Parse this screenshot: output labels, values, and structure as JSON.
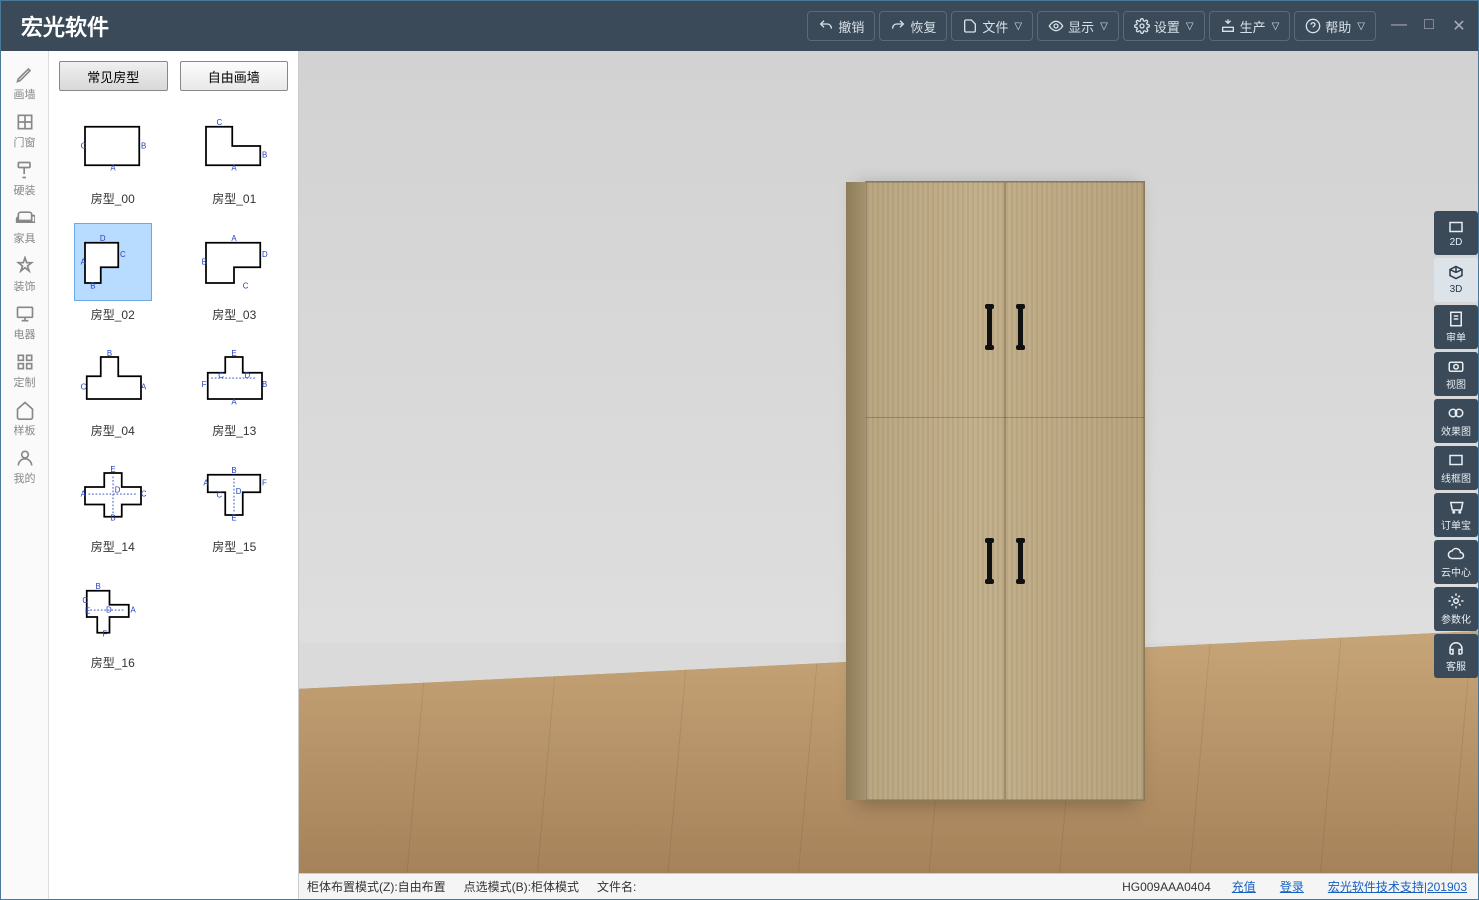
{
  "app": {
    "title": "宏光软件"
  },
  "titlebar": {
    "undo": "撤销",
    "redo": "恢复",
    "file": "文件",
    "display": "显示",
    "settings": "设置",
    "produce": "生产",
    "help": "帮助"
  },
  "leftnav": {
    "wall": "画墙",
    "door": "门窗",
    "hard": "硬装",
    "furniture": "家具",
    "decor": "装饰",
    "appliance": "电器",
    "custom": "定制",
    "template": "样板",
    "mine": "我的"
  },
  "sidepanel": {
    "tab_common": "常见房型",
    "tab_free": "自由画墙",
    "shapes": [
      {
        "id": "s00",
        "label": "房型_00"
      },
      {
        "id": "s01",
        "label": "房型_01"
      },
      {
        "id": "s02",
        "label": "房型_02"
      },
      {
        "id": "s03",
        "label": "房型_03"
      },
      {
        "id": "s04",
        "label": "房型_04"
      },
      {
        "id": "s13",
        "label": "房型_13"
      },
      {
        "id": "s14",
        "label": "房型_14"
      },
      {
        "id": "s15",
        "label": "房型_15"
      },
      {
        "id": "s16",
        "label": "房型_16"
      }
    ]
  },
  "righttools": {
    "twoD": "2D",
    "threeD": "3D",
    "review": "审单",
    "view": "视图",
    "render": "效果图",
    "wireframe": "线框图",
    "orderbao": "订单宝",
    "cloud": "云中心",
    "param": "参数化",
    "service": "客服"
  },
  "status": {
    "layout_mode": "柜体布置模式(Z):自由布置",
    "select_mode": "点选模式(B):柜体模式",
    "filename_label": "文件名:",
    "code": "HG009AAA0404",
    "recharge": "充值",
    "login": "登录",
    "support": "宏光软件技术支持|201903"
  }
}
